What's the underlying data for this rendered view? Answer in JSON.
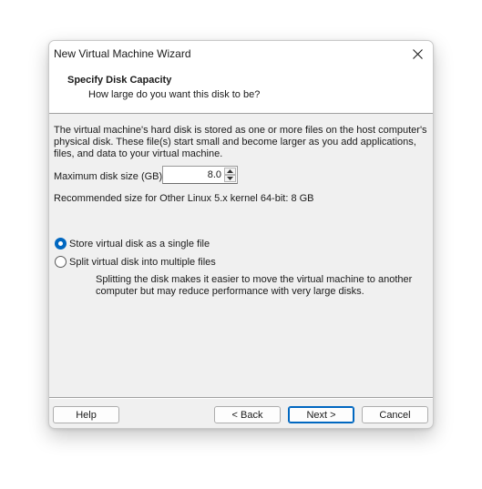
{
  "window": {
    "title": "New Virtual Machine Wizard"
  },
  "header": {
    "title": "Specify Disk Capacity",
    "subtitle": "How large do you want this disk to be?"
  },
  "content": {
    "description": "The virtual machine's hard disk is stored as one or more files on the host computer's physical disk. These file(s) start small and become larger as you add applications, files, and data to your virtual machine.",
    "max_size_label": "Maximum disk size (GB):",
    "max_size_value": "8.0",
    "recommendation": "Recommended size for Other Linux 5.x kernel 64-bit: 8 GB",
    "options": [
      {
        "label": "Store virtual disk as a single file",
        "selected": true
      },
      {
        "label": "Split virtual disk into multiple files",
        "selected": false
      }
    ],
    "split_note": "Splitting the disk makes it easier to move the virtual machine to another computer but may reduce performance with very large disks."
  },
  "footer": {
    "help_label": "Help",
    "back_label": "< Back",
    "next_label": "Next >",
    "cancel_label": "Cancel"
  },
  "colors": {
    "accent": "#0067c0",
    "dialog_bg": "#f0f0f0",
    "header_bg": "#ffffff"
  }
}
